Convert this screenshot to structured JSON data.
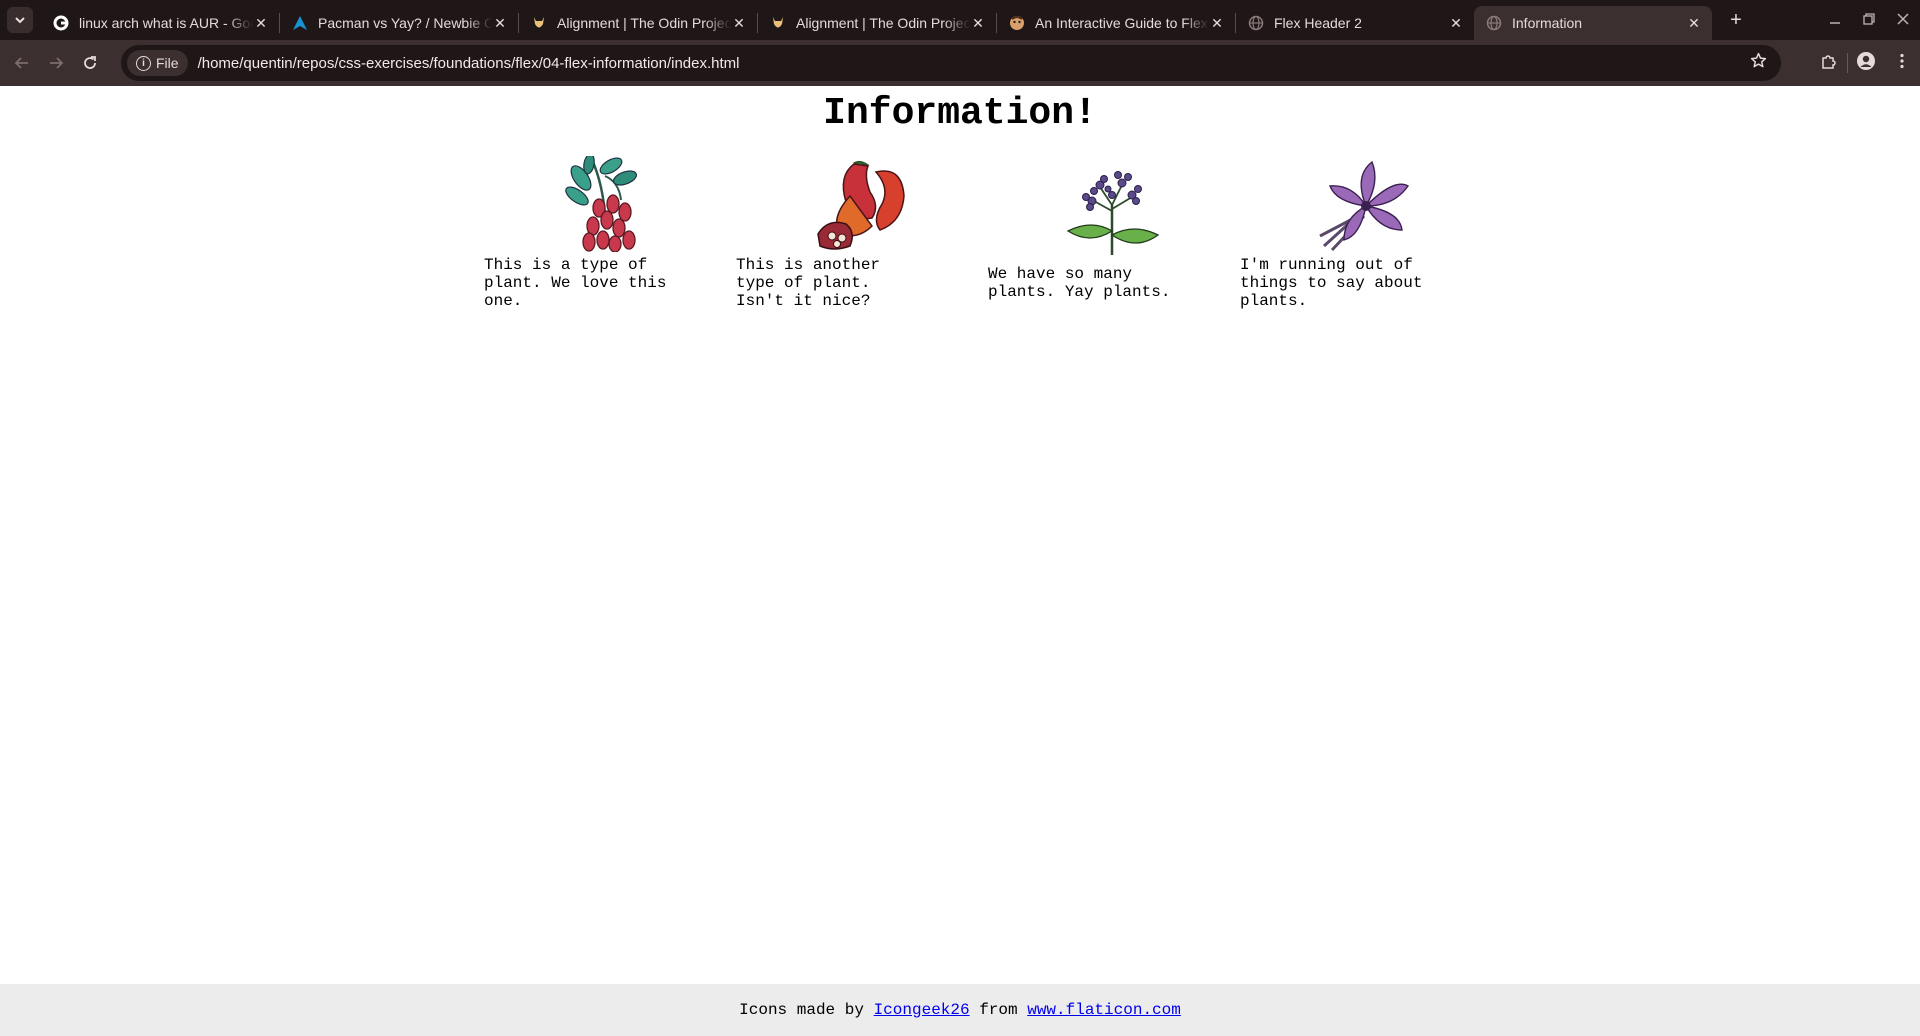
{
  "browser": {
    "tabs": [
      {
        "title": "linux arch what is AUR - Google Search",
        "favicon": "google-icon",
        "active": false
      },
      {
        "title": "Pacman vs Yay? / Newbie Corner",
        "favicon": "arch-icon",
        "active": false
      },
      {
        "title": "Alignment | The Odin Project",
        "favicon": "odin-icon",
        "active": false
      },
      {
        "title": "Alignment | The Odin Project",
        "favicon": "odin-icon",
        "active": false
      },
      {
        "title": "An Interactive Guide to Flexbox",
        "favicon": "josh-icon",
        "active": false
      },
      {
        "title": "Flex Header 2",
        "favicon": "globe-icon",
        "active": false
      },
      {
        "title": "Information",
        "favicon": "globe-icon",
        "active": true
      }
    ],
    "tab_close_glyph": "✕",
    "new_tab_glyph": "+",
    "address": {
      "chip_label": "File",
      "url": "/home/quentin/repos/css-exercises/foundations/flex/04-flex-information/index.html"
    }
  },
  "page": {
    "heading": "Information!",
    "cards": [
      {
        "icon": "red-berries-plant-icon",
        "text": "This is a type of plant. We love this one."
      },
      {
        "icon": "red-chili-flower-icon",
        "text": "This is another type of plant. Isn't it nice?"
      },
      {
        "icon": "purple-lilac-sprig-icon",
        "text": "We have so many plants. Yay plants."
      },
      {
        "icon": "violet-flower-icon",
        "text": "I'm running out of things to say about plants."
      }
    ],
    "footer": {
      "prefix": "Icons made by",
      "author_link": "Icongeek26",
      "middle": "from",
      "site_link": "www.flaticon.com"
    }
  }
}
